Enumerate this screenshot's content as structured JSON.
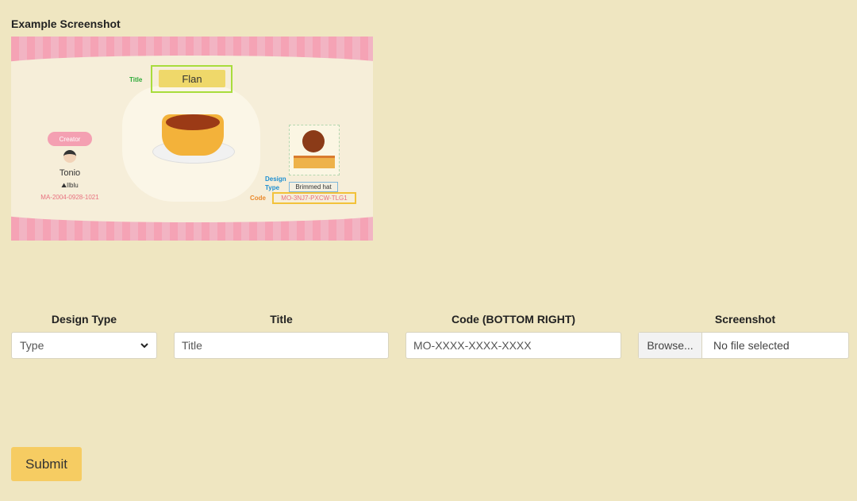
{
  "example": {
    "label": "Example Screenshot",
    "annotation_title": "Title",
    "banner_title": "Flan",
    "creator_label": "Creator",
    "creator_name": "Tonio",
    "creator_island": "Ilblu",
    "creator_code": "MA-2004-0928-1021",
    "annotation_design_type": "Design Type",
    "design_type_value": "Brimmed hat",
    "annotation_code": "Code",
    "code_value": "MO-3NJ7-PXCW-TLG1"
  },
  "form": {
    "design_type_label": "Design Type",
    "design_type_selected": "Type",
    "title_label": "Title",
    "title_placeholder": "Title",
    "code_label": "Code (BOTTOM RIGHT)",
    "code_placeholder": "MO-XXXX-XXXX-XXXX",
    "screenshot_label": "Screenshot",
    "browse_label": "Browse...",
    "file_status": "No file selected",
    "submit_label": "Submit"
  },
  "icons": {
    "select_arrow": "chevron-down-icon"
  }
}
